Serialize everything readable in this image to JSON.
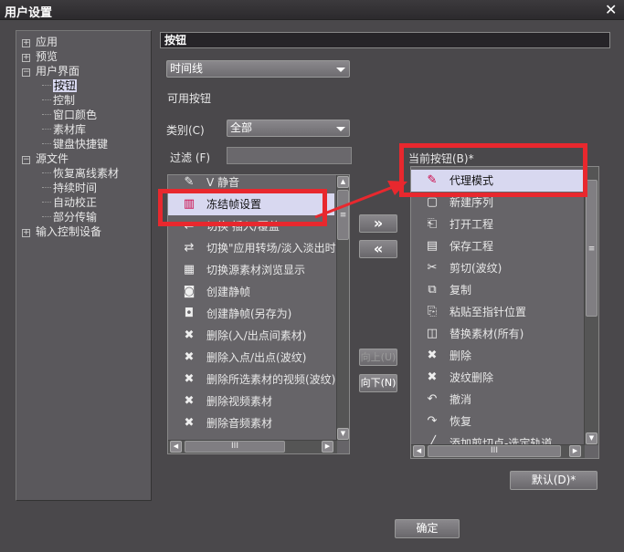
{
  "window": {
    "title": "用户设置",
    "close": "✕"
  },
  "tree": [
    {
      "label": "应用",
      "level": 0,
      "toggle": "+"
    },
    {
      "label": "预览",
      "level": 0,
      "toggle": "+"
    },
    {
      "label": "用户界面",
      "level": 0,
      "toggle": "−"
    },
    {
      "label": "按钮",
      "level": 1,
      "selected": true
    },
    {
      "label": "控制",
      "level": 1
    },
    {
      "label": "窗口颜色",
      "level": 1
    },
    {
      "label": "素材库",
      "level": 1
    },
    {
      "label": "键盘快捷键",
      "level": 1
    },
    {
      "label": "源文件",
      "level": 0,
      "toggle": "−"
    },
    {
      "label": "恢复离线素材",
      "level": 1
    },
    {
      "label": "持续时间",
      "level": 1
    },
    {
      "label": "自动校正",
      "level": 1
    },
    {
      "label": "部分传输",
      "level": 1
    },
    {
      "label": "输入控制设备",
      "level": 0,
      "toggle": "+"
    }
  ],
  "panel": {
    "header": "按钮",
    "location_select": "时间线",
    "available_label": "可用按钮",
    "category_label": "类别(C)",
    "category_select": "全部",
    "filter_label": "过滤 (F)",
    "filter_value": "",
    "current_label": "当前按钮(B)*",
    "add_button": "»",
    "remove_button": "«",
    "up_button": "向上(U)",
    "down_button": "向下(N)",
    "default_button": "默认(D)*",
    "ok_button": "确定"
  },
  "available": [
    {
      "icon": "✎",
      "label": "V 静音"
    },
    {
      "icon": "▥",
      "label": "冻结帧设置",
      "highlighted": true
    },
    {
      "icon": "⇌",
      "label": "切换 插入/覆盖"
    },
    {
      "icon": "⇄",
      "label": "切换\"应用转场/淡入淡出时"
    },
    {
      "icon": "▦",
      "label": "切换源素材浏览显示"
    },
    {
      "icon": "◙",
      "label": "创建静帧"
    },
    {
      "icon": "◘",
      "label": "创建静帧(另存为)"
    },
    {
      "icon": "✖",
      "label": "删除(入/出点间素材)"
    },
    {
      "icon": "✖",
      "label": "删除入点/出点(波纹)"
    },
    {
      "icon": "✖",
      "label": "删除所选素材的视频(波纹)"
    },
    {
      "icon": "✖",
      "label": "删除视频素材"
    },
    {
      "icon": "✖",
      "label": "删除音频素材"
    }
  ],
  "current": [
    {
      "icon": "✎",
      "label": "代理模式",
      "highlighted": true
    },
    {
      "icon": "▢",
      "label": "新建序列"
    },
    {
      "icon": "⎗",
      "label": "打开工程"
    },
    {
      "icon": "▤",
      "label": "保存工程"
    },
    {
      "icon": "✂",
      "label": "剪切(波纹)"
    },
    {
      "icon": "⧉",
      "label": "复制"
    },
    {
      "icon": "⎘",
      "label": "粘贴至指针位置"
    },
    {
      "icon": "◫",
      "label": "替换素材(所有)"
    },
    {
      "icon": "✖",
      "label": "删除"
    },
    {
      "icon": "✖",
      "label": "波纹删除"
    },
    {
      "icon": "↶",
      "label": "撤消"
    },
    {
      "icon": "↷",
      "label": "恢复"
    },
    {
      "icon": "╱",
      "label": "添加剪切点-选定轨道"
    }
  ],
  "colors": {
    "highlight_box": "#e8282e",
    "selection": "#d8d8f0"
  }
}
